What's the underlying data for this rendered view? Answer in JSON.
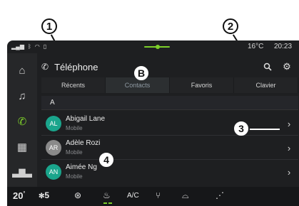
{
  "callouts": [
    "1",
    "2",
    "B",
    "3",
    "4"
  ],
  "status": {
    "temperature": "16°C",
    "time": "20:23",
    "icons": [
      "signal-icon",
      "bluetooth-icon",
      "wifi-icon",
      "sim-icon"
    ]
  },
  "sidebar": {
    "items": [
      {
        "icon": "home-icon",
        "glyph": "⌂"
      },
      {
        "icon": "music-icon",
        "glyph": "♫"
      },
      {
        "icon": "phone-icon",
        "glyph": "✆",
        "active": true
      },
      {
        "icon": "apps-icon",
        "glyph": "▦"
      },
      {
        "icon": "car-icon",
        "glyph": "🚗"
      }
    ]
  },
  "header": {
    "title": "Téléphone",
    "search_icon": "search-icon",
    "settings_icon": "gear-icon"
  },
  "tabs": [
    "Récents",
    "Contacts",
    "Favoris",
    "Clavier"
  ],
  "active_tab": "Contacts",
  "section_letter": "A",
  "contacts": [
    {
      "initials": "AL",
      "name": "Abigail Lane",
      "type": "Mobile",
      "color": "#1aa58c"
    },
    {
      "initials": "AR",
      "name": "Adèle Rozi",
      "type": "Mobile",
      "color": "#8a8a8a"
    },
    {
      "initials": "AN",
      "name": "Aimée Ng",
      "type": "Mobile",
      "color": "#1aa58c"
    }
  ],
  "bottombar": {
    "temp_left": "20",
    "fan": "5",
    "ac_label": "A/C"
  },
  "colors": {
    "accent": "#7dcf2a",
    "background": "#1e1f21"
  }
}
